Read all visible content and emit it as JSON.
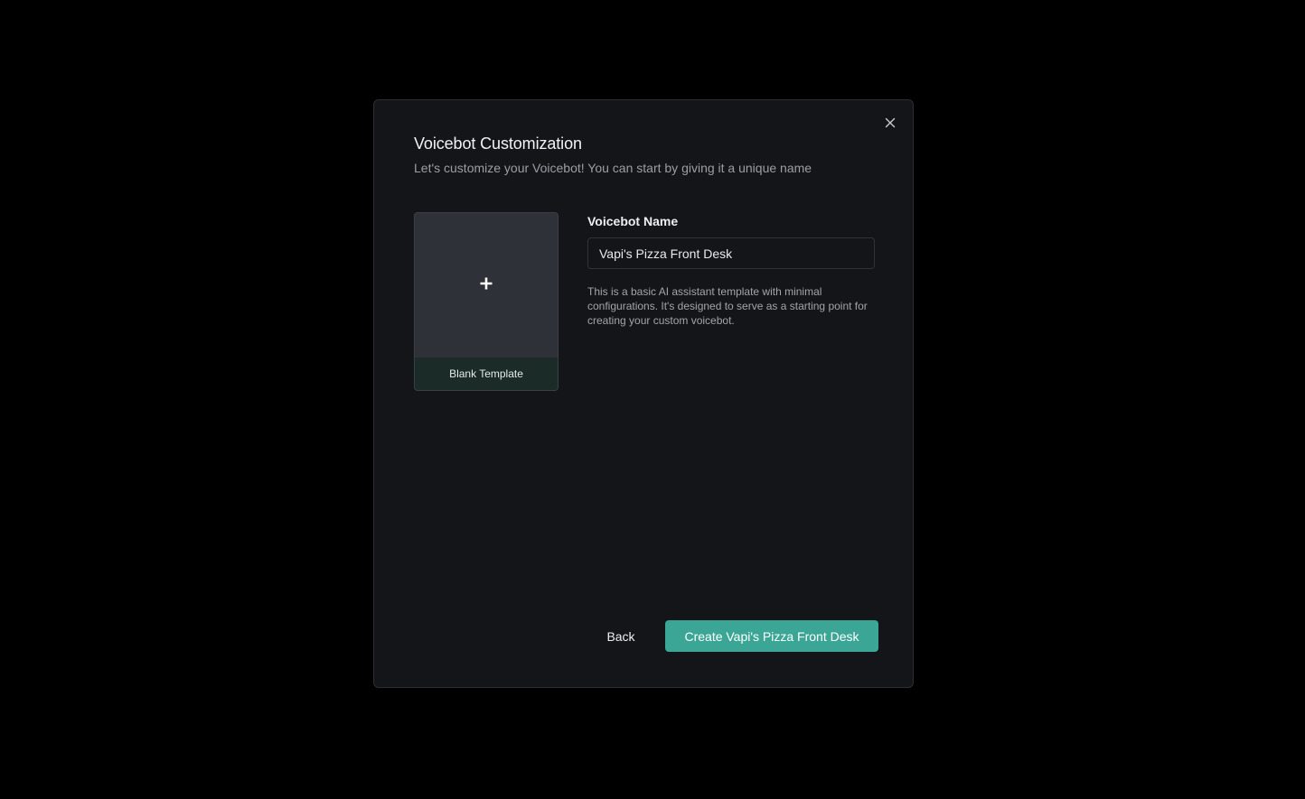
{
  "modal": {
    "title": "Voicebot Customization",
    "subtitle": "Let's customize your Voicebot! You can start by giving it a unique name",
    "close_icon": "close-icon"
  },
  "template_card": {
    "icon": "plus-icon",
    "label": "Blank Template"
  },
  "form": {
    "name_label": "Voicebot Name",
    "name_value": "Vapi's Pizza Front Desk",
    "description": "This is a basic AI assistant template with minimal configurations. It's designed to serve as a starting point for creating your custom voicebot."
  },
  "actions": {
    "back_label": "Back",
    "create_label": "Create Vapi's Pizza Front Desk"
  },
  "colors": {
    "backdrop": "#000000",
    "modal_bg": "#141518",
    "accent": "#3ba695",
    "card_label_bg": "#1a2b28"
  }
}
